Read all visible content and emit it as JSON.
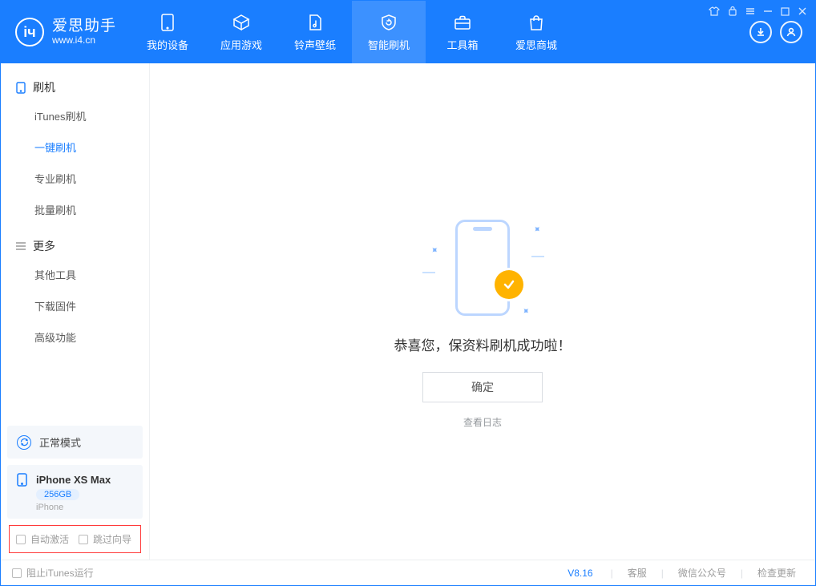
{
  "app": {
    "name": "爱思助手",
    "url": "www.i4.cn"
  },
  "header_tabs": {
    "device": "我的设备",
    "apps": "应用游戏",
    "ring": "铃声壁纸",
    "flash": "智能刷机",
    "tools": "工具箱",
    "store": "爱思商城"
  },
  "sidebar": {
    "sec_flash": "刷机",
    "items_flash": [
      "iTunes刷机",
      "一键刷机",
      "专业刷机",
      "批量刷机"
    ],
    "selected_flash_index": 1,
    "sec_more": "更多",
    "items_more": [
      "其他工具",
      "下载固件",
      "高级功能"
    ]
  },
  "device": {
    "mode": "正常模式",
    "name": "iPhone XS Max",
    "storage": "256GB",
    "type": "iPhone"
  },
  "options": {
    "auto_activate": "自动激活",
    "skip_guide": "跳过向导"
  },
  "main": {
    "message": "恭喜您，保资料刷机成功啦！",
    "confirm": "确定",
    "view_log": "查看日志"
  },
  "footer": {
    "block_itunes": "阻止iTunes运行",
    "version": "V8.16",
    "support": "客服",
    "wechat": "微信公众号",
    "update": "检查更新"
  }
}
